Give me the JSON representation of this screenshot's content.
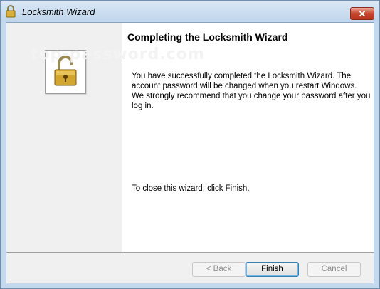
{
  "window": {
    "title": "Locksmith Wizard",
    "close_label": "✕"
  },
  "watermark": "top-password.com",
  "page": {
    "heading": "Completing the Locksmith Wizard",
    "message": "You have successfully completed the Locksmith Wizard. The account password will be changed when you restart Windows. We strongly recommend that you change your password after you log in.",
    "close_instruction": "To close this wizard, click Finish."
  },
  "buttons": {
    "back": "< Back",
    "finish": "Finish",
    "cancel": "Cancel"
  },
  "icons": {
    "title": "padlock-icon",
    "wizard": "unlocked-padlock-icon"
  }
}
